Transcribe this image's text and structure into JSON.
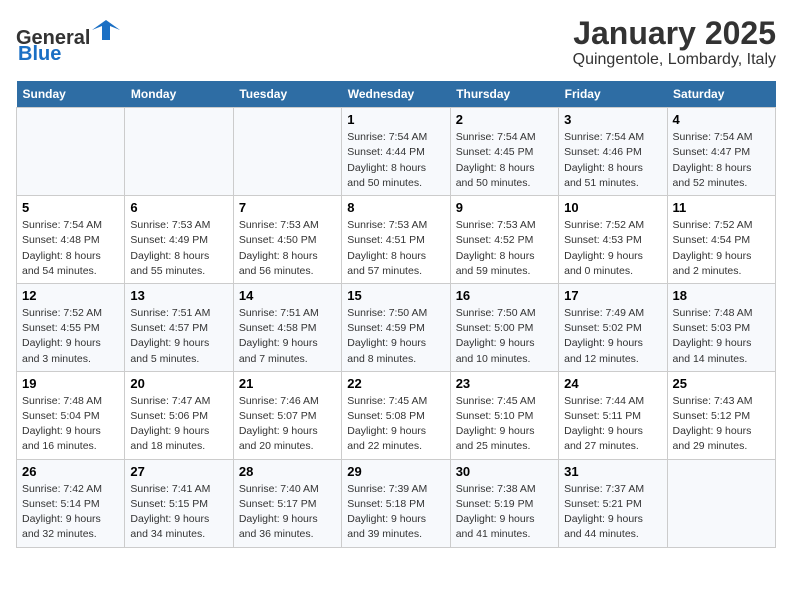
{
  "header": {
    "logo_line1": "General",
    "logo_line2": "Blue",
    "month": "January 2025",
    "location": "Quingentole, Lombardy, Italy"
  },
  "days_of_week": [
    "Sunday",
    "Monday",
    "Tuesday",
    "Wednesday",
    "Thursday",
    "Friday",
    "Saturday"
  ],
  "weeks": [
    [
      {
        "day": "",
        "info": ""
      },
      {
        "day": "",
        "info": ""
      },
      {
        "day": "",
        "info": ""
      },
      {
        "day": "1",
        "info": "Sunrise: 7:54 AM\nSunset: 4:44 PM\nDaylight: 8 hours\nand 50 minutes."
      },
      {
        "day": "2",
        "info": "Sunrise: 7:54 AM\nSunset: 4:45 PM\nDaylight: 8 hours\nand 50 minutes."
      },
      {
        "day": "3",
        "info": "Sunrise: 7:54 AM\nSunset: 4:46 PM\nDaylight: 8 hours\nand 51 minutes."
      },
      {
        "day": "4",
        "info": "Sunrise: 7:54 AM\nSunset: 4:47 PM\nDaylight: 8 hours\nand 52 minutes."
      }
    ],
    [
      {
        "day": "5",
        "info": "Sunrise: 7:54 AM\nSunset: 4:48 PM\nDaylight: 8 hours\nand 54 minutes."
      },
      {
        "day": "6",
        "info": "Sunrise: 7:53 AM\nSunset: 4:49 PM\nDaylight: 8 hours\nand 55 minutes."
      },
      {
        "day": "7",
        "info": "Sunrise: 7:53 AM\nSunset: 4:50 PM\nDaylight: 8 hours\nand 56 minutes."
      },
      {
        "day": "8",
        "info": "Sunrise: 7:53 AM\nSunset: 4:51 PM\nDaylight: 8 hours\nand 57 minutes."
      },
      {
        "day": "9",
        "info": "Sunrise: 7:53 AM\nSunset: 4:52 PM\nDaylight: 8 hours\nand 59 minutes."
      },
      {
        "day": "10",
        "info": "Sunrise: 7:52 AM\nSunset: 4:53 PM\nDaylight: 9 hours\nand 0 minutes."
      },
      {
        "day": "11",
        "info": "Sunrise: 7:52 AM\nSunset: 4:54 PM\nDaylight: 9 hours\nand 2 minutes."
      }
    ],
    [
      {
        "day": "12",
        "info": "Sunrise: 7:52 AM\nSunset: 4:55 PM\nDaylight: 9 hours\nand 3 minutes."
      },
      {
        "day": "13",
        "info": "Sunrise: 7:51 AM\nSunset: 4:57 PM\nDaylight: 9 hours\nand 5 minutes."
      },
      {
        "day": "14",
        "info": "Sunrise: 7:51 AM\nSunset: 4:58 PM\nDaylight: 9 hours\nand 7 minutes."
      },
      {
        "day": "15",
        "info": "Sunrise: 7:50 AM\nSunset: 4:59 PM\nDaylight: 9 hours\nand 8 minutes."
      },
      {
        "day": "16",
        "info": "Sunrise: 7:50 AM\nSunset: 5:00 PM\nDaylight: 9 hours\nand 10 minutes."
      },
      {
        "day": "17",
        "info": "Sunrise: 7:49 AM\nSunset: 5:02 PM\nDaylight: 9 hours\nand 12 minutes."
      },
      {
        "day": "18",
        "info": "Sunrise: 7:48 AM\nSunset: 5:03 PM\nDaylight: 9 hours\nand 14 minutes."
      }
    ],
    [
      {
        "day": "19",
        "info": "Sunrise: 7:48 AM\nSunset: 5:04 PM\nDaylight: 9 hours\nand 16 minutes."
      },
      {
        "day": "20",
        "info": "Sunrise: 7:47 AM\nSunset: 5:06 PM\nDaylight: 9 hours\nand 18 minutes."
      },
      {
        "day": "21",
        "info": "Sunrise: 7:46 AM\nSunset: 5:07 PM\nDaylight: 9 hours\nand 20 minutes."
      },
      {
        "day": "22",
        "info": "Sunrise: 7:45 AM\nSunset: 5:08 PM\nDaylight: 9 hours\nand 22 minutes."
      },
      {
        "day": "23",
        "info": "Sunrise: 7:45 AM\nSunset: 5:10 PM\nDaylight: 9 hours\nand 25 minutes."
      },
      {
        "day": "24",
        "info": "Sunrise: 7:44 AM\nSunset: 5:11 PM\nDaylight: 9 hours\nand 27 minutes."
      },
      {
        "day": "25",
        "info": "Sunrise: 7:43 AM\nSunset: 5:12 PM\nDaylight: 9 hours\nand 29 minutes."
      }
    ],
    [
      {
        "day": "26",
        "info": "Sunrise: 7:42 AM\nSunset: 5:14 PM\nDaylight: 9 hours\nand 32 minutes."
      },
      {
        "day": "27",
        "info": "Sunrise: 7:41 AM\nSunset: 5:15 PM\nDaylight: 9 hours\nand 34 minutes."
      },
      {
        "day": "28",
        "info": "Sunrise: 7:40 AM\nSunset: 5:17 PM\nDaylight: 9 hours\nand 36 minutes."
      },
      {
        "day": "29",
        "info": "Sunrise: 7:39 AM\nSunset: 5:18 PM\nDaylight: 9 hours\nand 39 minutes."
      },
      {
        "day": "30",
        "info": "Sunrise: 7:38 AM\nSunset: 5:19 PM\nDaylight: 9 hours\nand 41 minutes."
      },
      {
        "day": "31",
        "info": "Sunrise: 7:37 AM\nSunset: 5:21 PM\nDaylight: 9 hours\nand 44 minutes."
      },
      {
        "day": "",
        "info": ""
      }
    ]
  ]
}
